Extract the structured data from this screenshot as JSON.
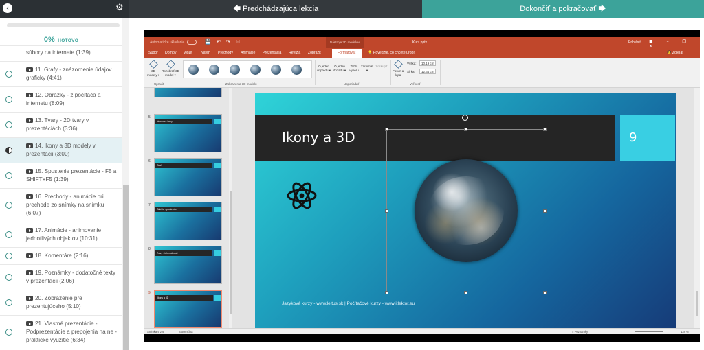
{
  "topbar": {
    "back_icon": "‹",
    "settings_icon": "⚙",
    "prev_label": "🡄 Predchádzajúca lekcia",
    "next_label": "Dokončiť a pokračovať 🡆"
  },
  "progress": {
    "percent_label": "0%",
    "status_label": "HOTOVO",
    "fraction": 0.0
  },
  "lessons": [
    {
      "title": "súbory na internete (1:39)",
      "state": "partial"
    },
    {
      "title": "11. Grafy - znázornenie údajov graficky (4:41)",
      "state": "todo"
    },
    {
      "title": "12. Obrázky - z počítača a internetu (8:09)",
      "state": "todo"
    },
    {
      "title": "13. Tvary - 2D tvary v prezentáciách (3:36)",
      "state": "todo"
    },
    {
      "title": "14. Ikony a 3D modely v prezentácii (3:00)",
      "state": "current"
    },
    {
      "title": "15. Spustenie prezentácie - F5 a SHIFT+F5 (1:39)",
      "state": "todo"
    },
    {
      "title": "16. Prechody - animácie pri prechode zo snímky na snímku (6:07)",
      "state": "todo"
    },
    {
      "title": "17. Animácie - animovanie jednotlivých objektov (10:31)",
      "state": "todo"
    },
    {
      "title": "18. Komentáre (2:16)",
      "state": "todo"
    },
    {
      "title": "19. Poznámky - dodatočné texty v prezentácii (2:06)",
      "state": "todo"
    },
    {
      "title": "20. Zobrazenie pre prezentujúceho (5:10)",
      "state": "todo"
    },
    {
      "title": "21. Vlastné prezentácie - Podprezentácie a prepojenia na ne - praktické využitie (6:34)",
      "state": "todo"
    }
  ],
  "powerpoint": {
    "autosave": "Automatické ukladanie",
    "quick_access": "💾 ↶ ↷ ⊡",
    "context_tab": "Nástroje 3D modelov",
    "filename": "Kurz.pptx",
    "signin": "Prihlásiť",
    "window_controls": "▣ – ❐ ✕",
    "ribbon_tabs": [
      "Súbor",
      "Domov",
      "Vložiť",
      "Návrh",
      "Prechody",
      "Animácie",
      "Prezentácia",
      "Revízia",
      "Zobraziť",
      "Formátovať"
    ],
    "active_tab": "Formátovať",
    "tell_me": "💡 Povedzte, čo chcete urobiť",
    "share": "🧑 Zdieľať",
    "ribbon": {
      "btn_3d_models": "3D modely ▾",
      "btn_reset": "Rozobrať 3D model ▾",
      "group_adjust": "Upraviť",
      "group_views": "Zobrazenia 3D modelu",
      "btn_forward": "O jeden dopredu ▾",
      "btn_backward": "O jeden dozadu ▾",
      "btn_selection": "Tabla výberu",
      "btn_align": "Zarovnať ▾",
      "btn_group": "Zoskupiť",
      "group_arrange": "Usporiadať",
      "btn_pan_zoom": "Posun a lupa",
      "height_label": "Výška:",
      "height_value": "10,19 cm",
      "width_label": "Šírka:",
      "width_value": "12,64 cm",
      "group_size": "Veľkosť"
    },
    "thumbnails": [
      {
        "num": "5",
        "title": "Návrhové tvary"
      },
      {
        "num": "6",
        "title": "Graf"
      },
      {
        "num": "7",
        "title": "Galéria - prostredie"
      },
      {
        "num": "8",
        "title": "Tvary - ich možnosti"
      },
      {
        "num": "9",
        "title": "Ikony a 3D"
      }
    ],
    "slide": {
      "title": "Ikony a 3D",
      "number": "9",
      "footer": "Jazykové kurzy - www.leitus.sk | Počítačové kurzy - www.itlektor.eu"
    },
    "status": {
      "slide_counter": "Snímka 9 z 9",
      "language": "Slovenčina",
      "notes": "≡ Poznámky",
      "zoom": "118 %"
    }
  }
}
